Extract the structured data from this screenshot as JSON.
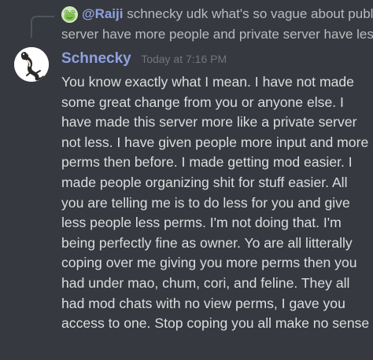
{
  "reply": {
    "mention": "@Raiji",
    "text_line1": "schnecky udk what's so vague about public",
    "text_line2": "server have more people and private server have less"
  },
  "message": {
    "username": "Schnecky",
    "timestamp": "Today at 7:16 PM",
    "content": "You know exactly what I mean. I have not made some great change from you or anyone else. I have made this server more like a private server not less. I have given people more input and more perms then before. I made getting mod easier. I made people organizing shit for stuff easier. All you are telling me is to do less for you and give less people less perms. I'm not doing that. I'm being perfectly fine as owner. Yo are all litterally coping over me giving you more perms then you had under mao, chum, cori, and feline. They all had mod chats with no view perms, I gave you access to one. Stop coping you all make no sense"
  },
  "colors": {
    "background": "#36393f",
    "username": "#8ea1e1",
    "mention": "#8ea1e1",
    "message_text": "#dcddde",
    "reply_text": "#b9bbbe",
    "timestamp": "#72767d"
  }
}
